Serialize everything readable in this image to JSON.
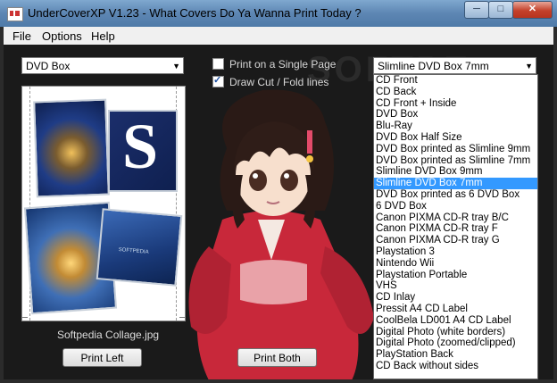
{
  "window": {
    "title": "UnderCoverXP V1.23 - What Covers Do Ya Wanna Print Today ?",
    "min_label": "─",
    "max_label": "□",
    "close_label": "✕"
  },
  "menu": [
    "File",
    "Options",
    "Help"
  ],
  "watermark": "SOFTPE",
  "left_combo": {
    "value": "DVD Box"
  },
  "options": {
    "single_page": {
      "label": "Print on a Single Page",
      "checked": false
    },
    "cut_lines": {
      "label": "Draw Cut / Fold lines",
      "checked": true
    }
  },
  "right_combo": {
    "value": "Slimline DVD Box 7mm"
  },
  "dropdown": {
    "items": [
      "CD Front",
      "CD Back",
      "CD Front + Inside",
      "DVD Box",
      "Blu-Ray",
      "DVD Box Half Size",
      "DVD Box printed as Slimline 9mm",
      "DVD Box printed as Slimline 7mm",
      "Slimline DVD Box 9mm",
      "Slimline DVD Box 7mm",
      "DVD Box printed as 6 DVD Box",
      "6 DVD Box",
      "Canon PIXMA CD-R tray B/C",
      "Canon PIXMA CD-R tray F",
      "Canon PIXMA CD-R tray G",
      "Playstation 3",
      "Nintendo Wii",
      "Playstation Portable",
      "VHS",
      "CD Inlay",
      "Pressit A4 CD Label",
      "CoolBela LD001 A4 CD Label",
      "Digital Photo (white borders)",
      "Digital Photo (zoomed/clipped)",
      "PlayStation Back",
      "CD Back without sides"
    ],
    "selected_index": 9
  },
  "preview": {
    "caption": "Softpedia Collage.jpg",
    "letter": "S",
    "tile_text": "SOFTPEDIA"
  },
  "buttons": {
    "print_left": "Print Left",
    "print_both": "Print Both"
  },
  "colors": {
    "titlebar": "#5d86b3",
    "selection": "#3399ff",
    "kimono": "#c8283a"
  }
}
